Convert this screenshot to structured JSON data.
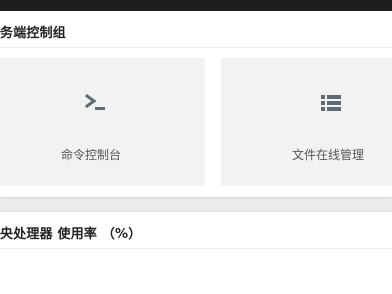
{
  "server_group": {
    "title": "务端控制组",
    "cards": [
      {
        "label": "命令控制台",
        "icon": "terminal-icon"
      },
      {
        "label": "文件在线管理",
        "icon": "list-icon"
      }
    ]
  },
  "cpu_panel": {
    "title": "央处理器 使用率 （%）"
  },
  "colors": {
    "card_bg": "#f2f2f2",
    "icon": "#5f6b73",
    "top_bar": "#1e1e1e"
  }
}
